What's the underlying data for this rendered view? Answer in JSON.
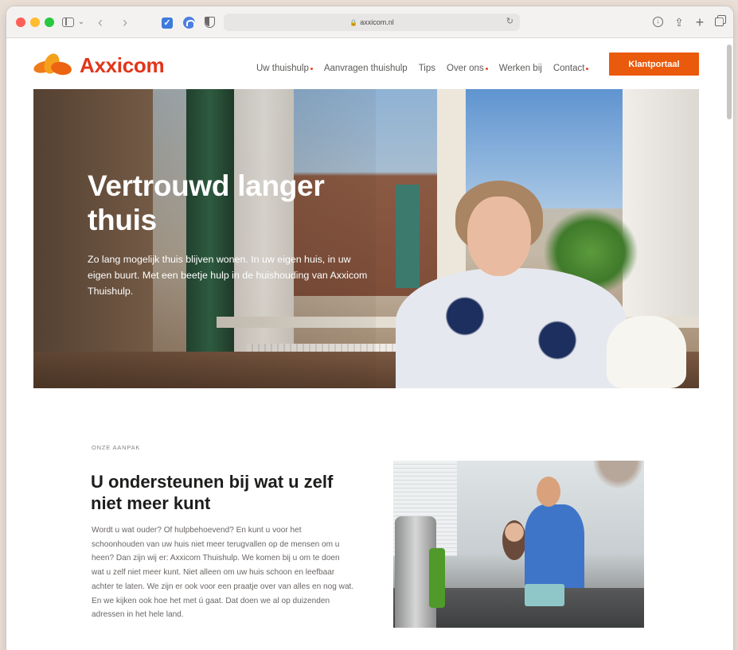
{
  "browser": {
    "url": "axxicom.nl"
  },
  "site": {
    "logo_text": "Axxicom",
    "nav": [
      {
        "label": "Uw thuishulp",
        "has_dropdown": true
      },
      {
        "label": "Aanvragen thuishulp",
        "has_dropdown": false
      },
      {
        "label": "Tips",
        "has_dropdown": false
      },
      {
        "label": "Over ons",
        "has_dropdown": true
      },
      {
        "label": "Werken bij",
        "has_dropdown": false
      },
      {
        "label": "Contact",
        "has_dropdown": true
      }
    ],
    "cta_label": "Klantportaal",
    "brand_color": "#e2351a",
    "cta_color": "#ea5a0c"
  },
  "hero": {
    "title": "Vertrouwd langer thuis",
    "text": "Zo lang mogelijk thuis blijven wonen. In uw eigen huis, in uw eigen buurt. Met een beetje hulp in de huishouding van Axxicom Thuishulp."
  },
  "section": {
    "eyebrow": "ONZE AANPAK",
    "title": "U ondersteunen bij wat u zelf niet meer kunt",
    "body": "Wordt u wat ouder? Of hulpbehoevend? En kunt u voor het schoonhouden van uw huis niet meer terugvallen op de mensen om u heen? Dan zijn wij er: Axxicom Thuishulp. We komen bij u om te doen wat u zelf niet meer kunt. Niet alleen om uw huis schoon en leefbaar achter te laten. We zijn er ook voor een praatje over van alles en nog wat. En we kijken ook hoe het met ú gaat. Dat doen we al op duizenden adressen in het hele land."
  }
}
